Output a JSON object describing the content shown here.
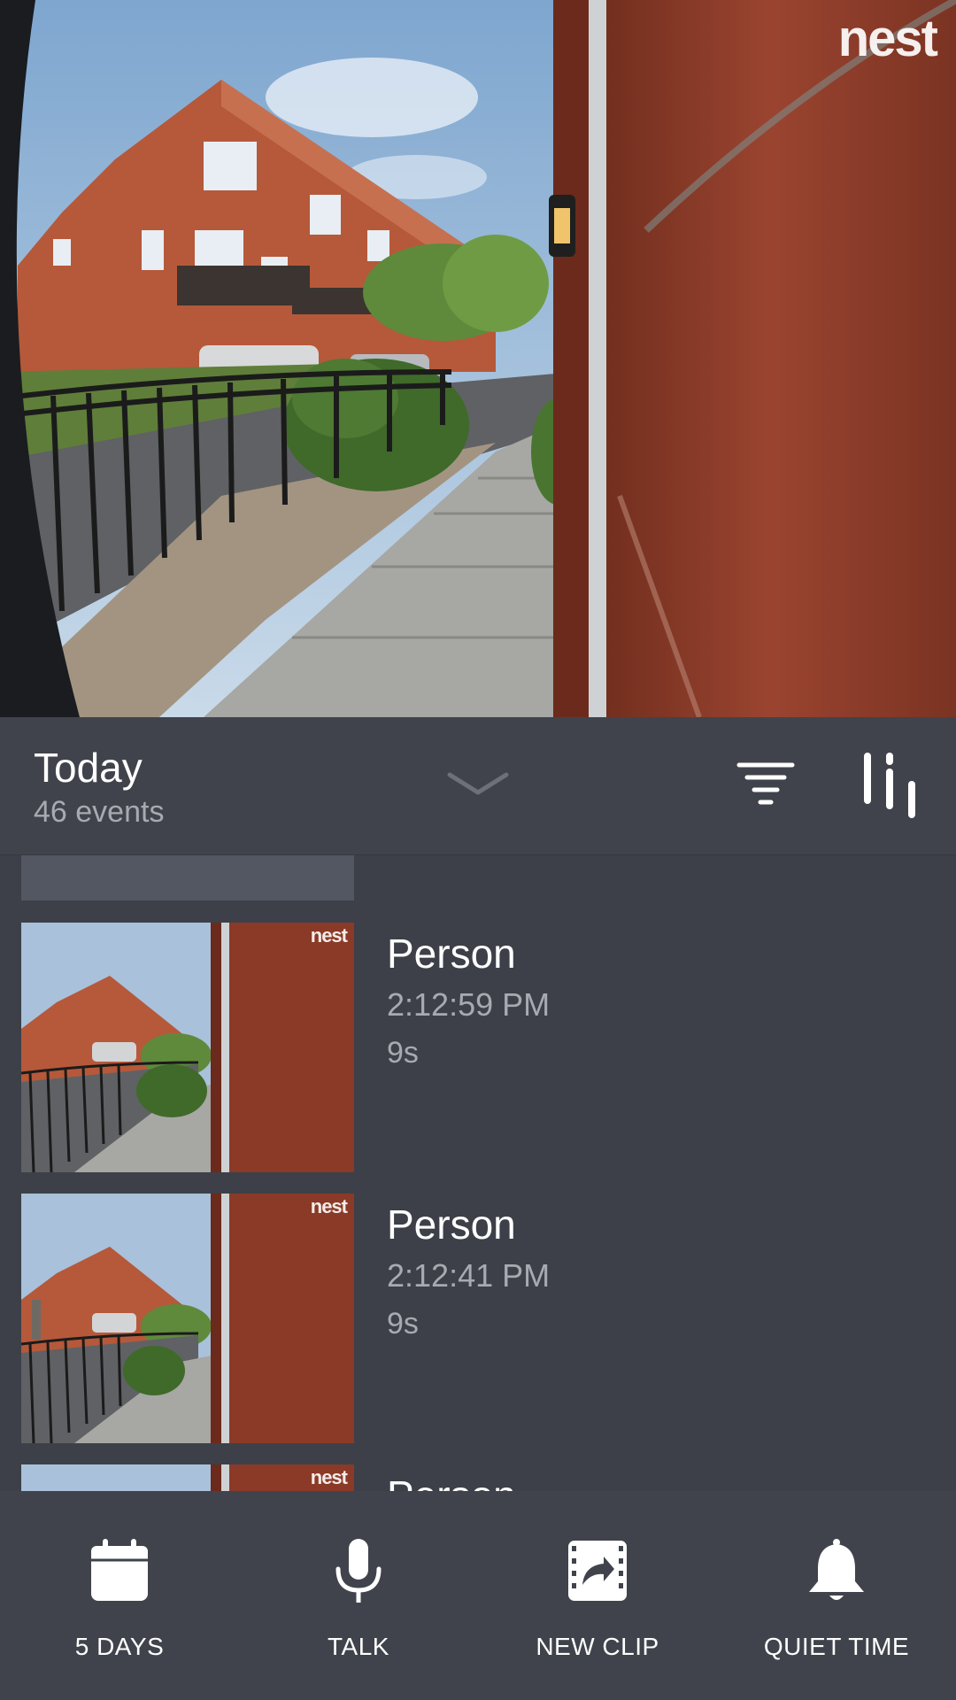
{
  "camera": {
    "logo": "nest"
  },
  "header": {
    "title": "Today",
    "subtitle": "46 events"
  },
  "events": [
    {
      "type": "Person",
      "time": "2:12:59 PM",
      "duration": "9s",
      "logo": "nest"
    },
    {
      "type": "Person",
      "time": "2:12:41 PM",
      "duration": "9s",
      "logo": "nest"
    },
    {
      "type": "Person",
      "time": "",
      "duration": "",
      "logo": "nest"
    }
  ],
  "toolbar": {
    "items": [
      {
        "label": "5 DAYS",
        "icon": "calendar-icon"
      },
      {
        "label": "TALK",
        "icon": "microphone-icon"
      },
      {
        "label": "NEW CLIP",
        "icon": "clip-share-icon"
      },
      {
        "label": "QUIET TIME",
        "icon": "bell-icon"
      }
    ]
  },
  "colors": {
    "background": "#3d4048",
    "header": "#40434b",
    "secondary_text": "#a7aab1",
    "brick": "#8e3b26"
  }
}
